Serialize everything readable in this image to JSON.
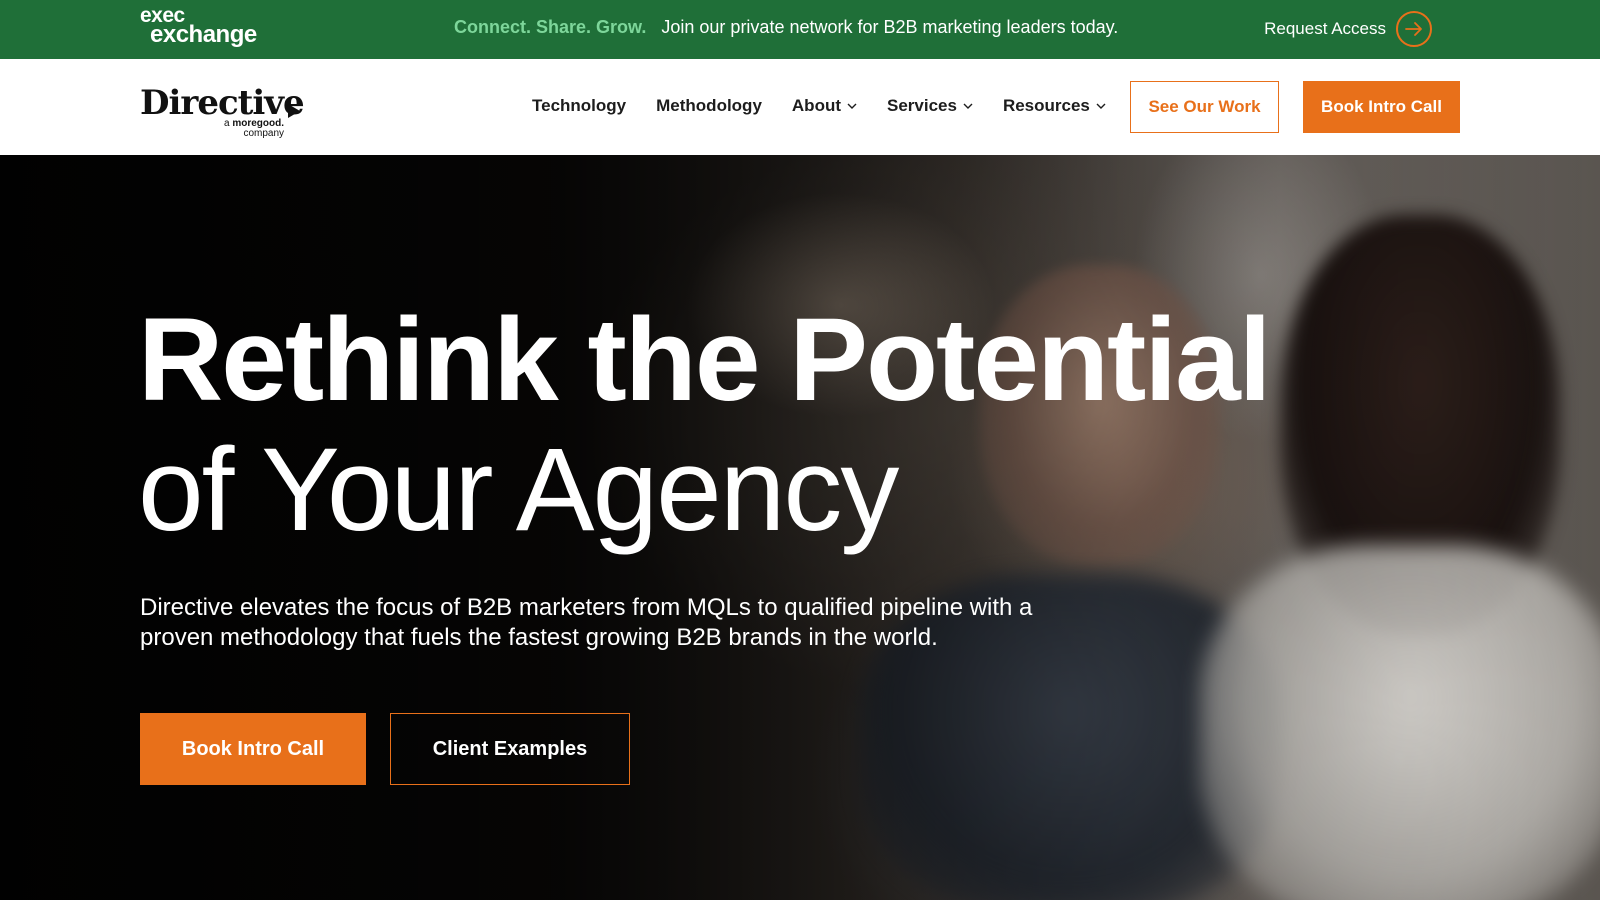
{
  "topbar": {
    "logo_line1": "exec",
    "logo_line2": "exchange",
    "tagline": "Connect. Share. Grow.",
    "message": "Join our private network for B2B marketing leaders today.",
    "request_label": "Request Access",
    "request_icon": "arrow-right-circle-icon",
    "bg_color": "#1f6f38",
    "tag_color": "#7dd69a"
  },
  "nav": {
    "brand_name": "Directive",
    "brand_sub_prefix": "a",
    "brand_sub_bold": "moregood.",
    "brand_sub_suffix": "company",
    "items": [
      {
        "label": "Technology",
        "has_dropdown": false
      },
      {
        "label": "Methodology",
        "has_dropdown": false
      },
      {
        "label": "About",
        "has_dropdown": true
      },
      {
        "label": "Services",
        "has_dropdown": true
      },
      {
        "label": "Resources",
        "has_dropdown": true
      }
    ],
    "see_work_label": "See Our Work",
    "book_call_label": "Book Intro Call",
    "accent_color": "#e8701a"
  },
  "hero": {
    "headline_line1": "Rethink the Potential",
    "headline_line2": "of Your Agency",
    "subtext": "Directive elevates the focus of B2B marketers from MQLs to qualified pipeline with a proven methodology that fuels the fastest growing B2B brands in the world.",
    "primary_button": "Book Intro Call",
    "secondary_button": "Client Examples"
  }
}
